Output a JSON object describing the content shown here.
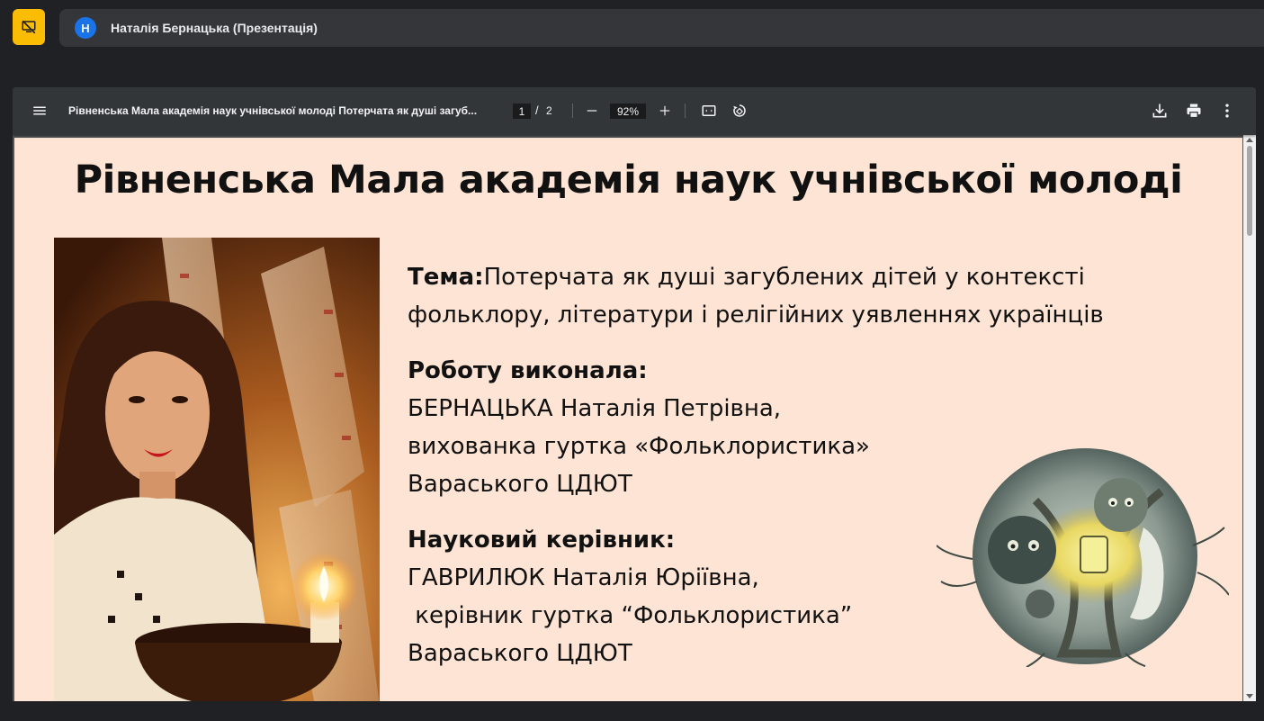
{
  "meeting": {
    "presenter_avatar_initial": "Н",
    "presenter_name": "Наталія Бернацька (Презентація)"
  },
  "pdf_toolbar": {
    "doc_title": "Рівненська Мала академія наук учнівської молоді Потерчата як душі загуб...",
    "page_current": "1",
    "page_separator": "/",
    "page_total": "2",
    "zoom": "92%"
  },
  "slide": {
    "title": "Рівненська Мала академія наук учнівської молоді",
    "topic_label": "Тема:",
    "topic_line1": "Потерчата як душі загублених дітей у контексті",
    "topic_line2": "фольклору, літератури і релігійних уявленнях українців",
    "author_label": "Роботу виконала:",
    "author_lines": [
      "БЕРНАЦЬКА Наталія Петрівна,",
      "вихованка гуртка «Фольклористика»",
      "Вараського ЦДЮТ"
    ],
    "supervisor_label": "Науковий керівник:",
    "supervisor_lines": [
      "ГАВРИЛЮК Наталія Юріївна,",
      " керівник гуртка “Фольклористика”",
      "Вараського ЦДЮТ"
    ]
  },
  "colors": {
    "present_button": "#fbbc04",
    "avatar": "#1a73e8",
    "slide_background": "#fde4d4",
    "toolbar": "#323639"
  },
  "icons": {
    "present": "stop-presenting-icon",
    "menu": "menu-icon",
    "zoom_out": "minus-icon",
    "zoom_in": "plus-icon",
    "fit": "fit-to-page-icon",
    "rotate": "rotate-icon",
    "download": "download-icon",
    "print": "print-icon",
    "more": "more-vert-icon"
  }
}
